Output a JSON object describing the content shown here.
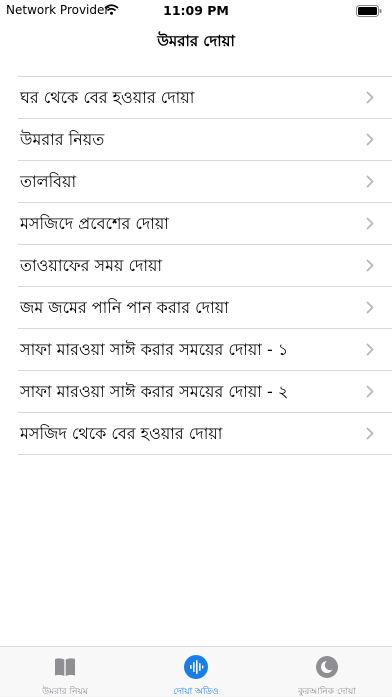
{
  "status_bar": {
    "carrier": "Network Provider",
    "time": "11:09 PM"
  },
  "nav": {
    "title": "উমরার দোয়া"
  },
  "list": {
    "items": [
      {
        "label": "ঘর থেকে বের হওয়ার দোয়া"
      },
      {
        "label": "উমরার নিয়ত"
      },
      {
        "label": "তালবিয়া"
      },
      {
        "label": "মসজিদে প্রবেশের দোয়া"
      },
      {
        "label": "তাওয়াফের সময় দোয়া"
      },
      {
        "label": "জম জমের পানি পান করার দোয়া"
      },
      {
        "label": "সাফা মারওয়া সাঈ করার সময়ের দোয়া - ১"
      },
      {
        "label": "সাফা মারওয়া সাঈ করার সময়ের দোয়া - ২"
      },
      {
        "label": "মসজিদ থেকে বের হওয়ার দোয়া"
      }
    ]
  },
  "tab_bar": {
    "tabs": [
      {
        "label": "উমরার নিয়ম",
        "icon": "book-icon",
        "active": false
      },
      {
        "label": "দোয়া অডিও",
        "icon": "audio-wave-icon",
        "active": true
      },
      {
        "label": "কুরআনিক দোয়া",
        "icon": "crescent-moon-icon",
        "active": false
      }
    ]
  },
  "colors": {
    "accent": "#1a7ee8",
    "inactive": "#8e8e93",
    "separator": "#d8d8dc"
  }
}
